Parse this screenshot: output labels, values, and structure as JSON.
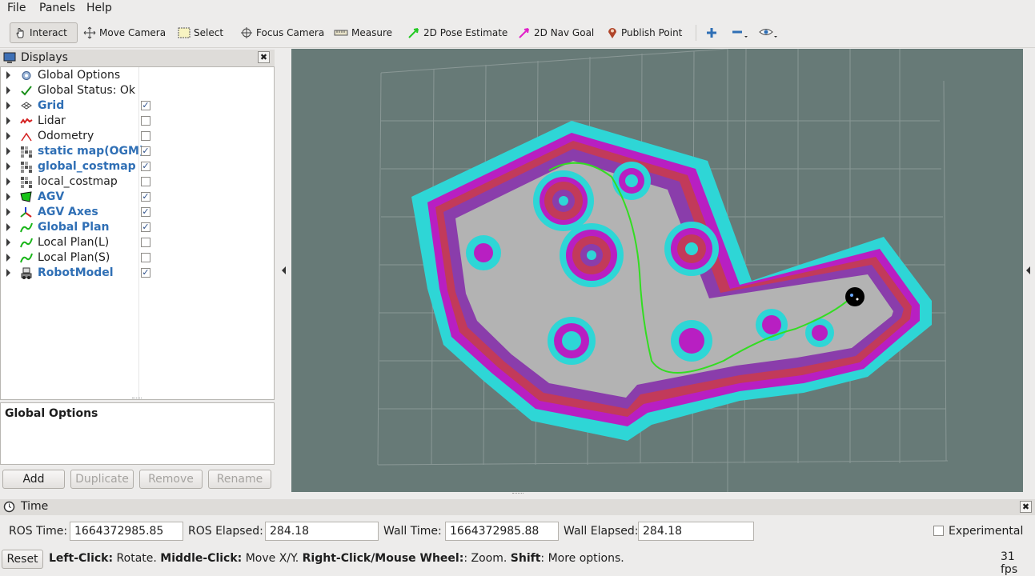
{
  "menu": [
    "File",
    "Panels",
    "Help"
  ],
  "toolbar": {
    "interact": "Interact",
    "move_camera": "Move Camera",
    "select": "Select",
    "focus_camera": "Focus Camera",
    "measure": "Measure",
    "pose_estimate": "2D Pose Estimate",
    "nav_goal": "2D Nav Goal",
    "publish_point": "Publish Point"
  },
  "displays": {
    "title": "Displays",
    "items": [
      {
        "label": "Global Options",
        "icon": "gear-icon",
        "bold": false,
        "checked": null
      },
      {
        "label": "Global Status: Ok",
        "icon": "checkmark-icon",
        "bold": false,
        "checked": null
      },
      {
        "label": "Grid",
        "icon": "grid-icon",
        "bold": true,
        "checked": true
      },
      {
        "label": "Lidar",
        "icon": "lidar-icon",
        "bold": false,
        "checked": false
      },
      {
        "label": "Odometry",
        "icon": "odometry-icon",
        "bold": false,
        "checked": false
      },
      {
        "label": "static map(OGM)",
        "icon": "map-icon",
        "bold": true,
        "checked": true
      },
      {
        "label": "global_costmap",
        "icon": "map-icon",
        "bold": true,
        "checked": true
      },
      {
        "label": "local_costmap",
        "icon": "map-icon",
        "bold": false,
        "checked": false
      },
      {
        "label": "AGV",
        "icon": "polygon-icon",
        "bold": true,
        "checked": true
      },
      {
        "label": "AGV Axes",
        "icon": "axes-icon",
        "bold": true,
        "checked": true
      },
      {
        "label": "Global Plan",
        "icon": "path-icon",
        "bold": true,
        "checked": true
      },
      {
        "label": "Local Plan(L)",
        "icon": "path-icon",
        "bold": false,
        "checked": false
      },
      {
        "label": "Local Plan(S)",
        "icon": "path-icon",
        "bold": false,
        "checked": false
      },
      {
        "label": "RobotModel",
        "icon": "robot-icon",
        "bold": true,
        "checked": true
      }
    ],
    "description_title": "Global Options",
    "buttons": {
      "add": "Add",
      "duplicate": "Duplicate",
      "remove": "Remove",
      "rename": "Rename"
    }
  },
  "time": {
    "title": "Time",
    "ros_time_label": "ROS Time:",
    "ros_time": "1664372985.85",
    "ros_elapsed_label": "ROS Elapsed:",
    "ros_elapsed": "284.18",
    "wall_time_label": "Wall Time:",
    "wall_time": "1664372985.88",
    "wall_elapsed_label": "Wall Elapsed:",
    "wall_elapsed": "284.18",
    "experimental_label": "Experimental"
  },
  "status": {
    "reset": "Reset",
    "left_click_key": "Left-Click:",
    "left_click_val": " Rotate.",
    "middle_click_key": "Middle-Click:",
    "middle_click_val": " Move X/Y.",
    "right_click_key": "Right-Click/Mouse Wheel:",
    "right_click_val": ": Zoom.",
    "shift_key": "Shift",
    "shift_val": ": More options.",
    "fps": "31 fps"
  },
  "colors": {
    "viewport_bg": "#677a77",
    "costmap_cyan": "#2ed6d6",
    "costmap_magenta": "#b81fc2",
    "costmap_red": "#c23a5a",
    "free_space": "#b3b3b3",
    "plan_green": "#33dd22"
  }
}
